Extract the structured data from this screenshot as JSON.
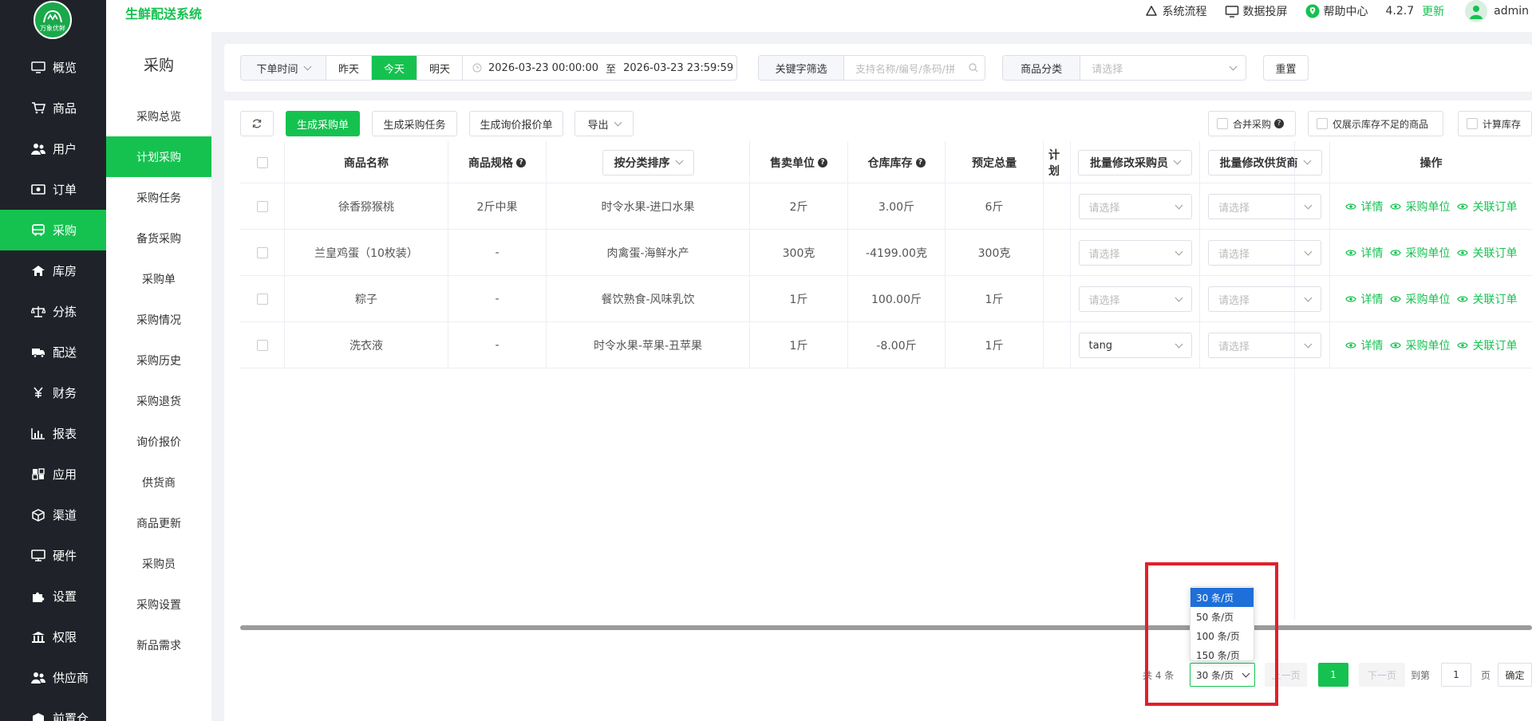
{
  "header": {
    "app_title": "生鲜配送系统",
    "process": "系统流程",
    "screen": "数据投屏",
    "help": "帮助中心",
    "version": "4.2.7",
    "update": "更新",
    "user": "admin",
    "logo_text": "万象优鲜"
  },
  "sidebar": {
    "items": [
      {
        "label": "概览",
        "icon": "monitor-icon"
      },
      {
        "label": "商品",
        "icon": "cart-icon"
      },
      {
        "label": "用户",
        "icon": "users-icon"
      },
      {
        "label": "订单",
        "icon": "money-icon"
      },
      {
        "label": "采购",
        "icon": "purchase-icon"
      },
      {
        "label": "库房",
        "icon": "home-icon"
      },
      {
        "label": "分拣",
        "icon": "scale-icon"
      },
      {
        "label": "配送",
        "icon": "truck-icon"
      },
      {
        "label": "财务",
        "icon": "yen-icon"
      },
      {
        "label": "报表",
        "icon": "chart-icon"
      },
      {
        "label": "应用",
        "icon": "apps-icon"
      },
      {
        "label": "渠道",
        "icon": "cube-icon"
      },
      {
        "label": "硬件",
        "icon": "desktop-icon"
      },
      {
        "label": "设置",
        "icon": "puzzle-icon"
      },
      {
        "label": "权限",
        "icon": "bank-icon"
      },
      {
        "label": "供应商",
        "icon": "supplier-icon"
      },
      {
        "label": "前置仓",
        "icon": "warehouse-icon"
      }
    ],
    "active_index": 4
  },
  "subnav": {
    "title": "采购",
    "items": [
      "采购总览",
      "计划采购",
      "采购任务",
      "备货采购",
      "采购单",
      "采购情况",
      "采购历史",
      "采购退货",
      "询价报价",
      "供货商",
      "商品更新",
      "采购员",
      "采购设置",
      "新品需求"
    ],
    "active_index": 1
  },
  "filter": {
    "time_type": "下单时间",
    "yesterday": "昨天",
    "today": "今天",
    "tomorrow": "明天",
    "start": "2026-03-23 00:00:00",
    "to": "至",
    "end": "2026-03-23 23:59:59",
    "keyword_label": "关键字筛选",
    "keyword_placeholder": "支持名称/编号/条码/拼",
    "category_label": "商品分类",
    "category_placeholder": "请选择",
    "reset": "重置"
  },
  "toolbar": {
    "gen_order": "生成采购单",
    "gen_task": "生成采购任务",
    "gen_inquiry": "生成询价报价单",
    "export": "导出",
    "merge": "合并采购",
    "only_short": "仅展示库存不足的商品",
    "calc_stock": "计算库存"
  },
  "table": {
    "headers": {
      "name": "商品名称",
      "spec": "商品规格",
      "sort": "按分类排序",
      "unit": "售卖单位",
      "stock": "仓库库存",
      "total": "预定总量",
      "plan": "计划",
      "buyer": "批量修改采购员",
      "supplier": "批量修改供货商",
      "ops": "操作"
    },
    "rows": [
      {
        "name": "徐香猕猴桃",
        "spec": "2斤中果",
        "category": "时令水果-进口水果",
        "unit": "2斤",
        "stock": "3.00斤",
        "total": "6斤",
        "buyer": "请选择",
        "supplier": "请选择"
      },
      {
        "name": "兰皇鸡蛋（10枚装）",
        "spec": "-",
        "category": "肉禽蛋-海鲜水产",
        "unit": "300克",
        "stock": "-4199.00克",
        "total": "300克",
        "buyer": "请选择",
        "supplier": "请选择"
      },
      {
        "name": "粽子",
        "spec": "-",
        "category": "餐饮熟食-风味乳饮",
        "unit": "1斤",
        "stock": "100.00斤",
        "total": "1斤",
        "buyer": "请选择",
        "supplier": "请选择"
      },
      {
        "name": "洗衣液",
        "spec": "-",
        "category": "时令水果-苹果-丑苹果",
        "unit": "1斤",
        "stock": "-8.00斤",
        "total": "1斤",
        "buyer": "tang",
        "supplier": "请选择"
      }
    ],
    "ops": {
      "detail": "详情",
      "unit": "采购单位",
      "order": "关联订单"
    }
  },
  "pager": {
    "total": "共 4 条",
    "size": "30 条/页",
    "prev": "上一页",
    "current": "1",
    "next": "下一页",
    "goto": "到第",
    "page_input": "1",
    "page": "页",
    "confirm": "确定"
  },
  "dropdown": {
    "options": [
      "30 条/页",
      "50 条/页",
      "100 条/页",
      "150 条/页"
    ],
    "selected_index": 0
  },
  "colors": {
    "accent": "#15c250",
    "sidebar": "#1f2329",
    "highlight": "#e0202a"
  }
}
